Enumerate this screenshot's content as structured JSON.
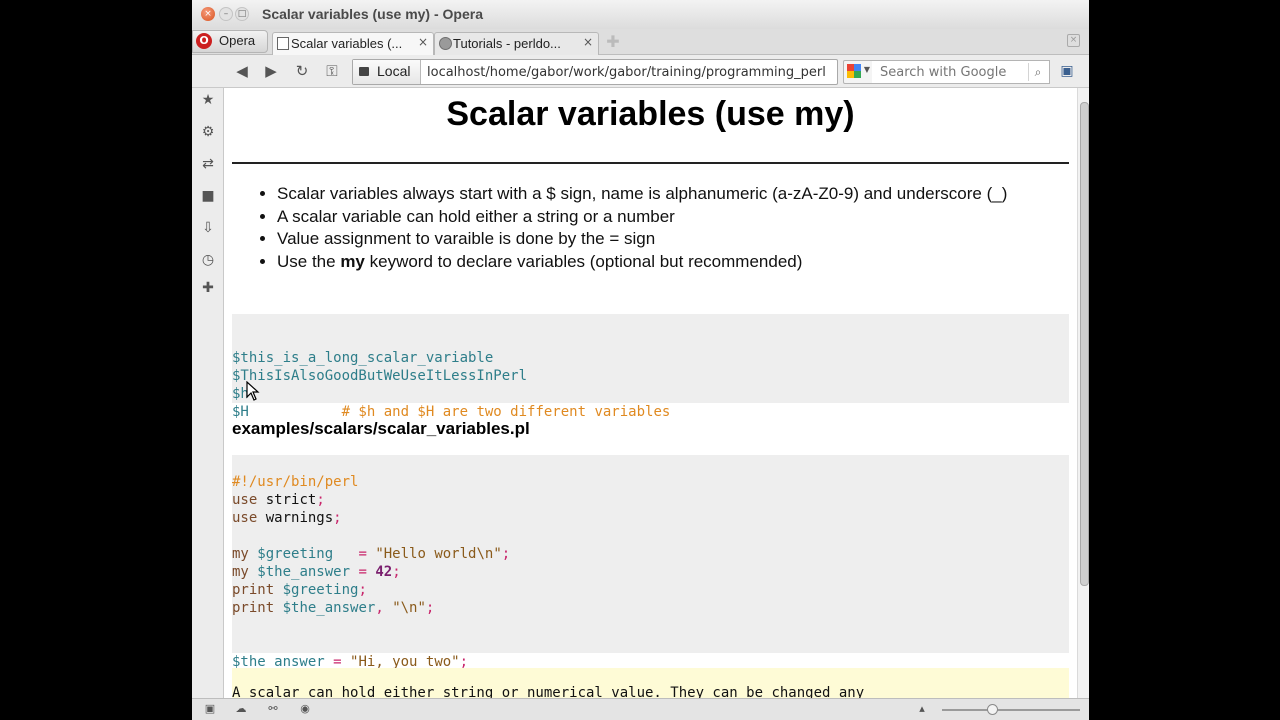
{
  "window": {
    "title": "Scalar variables (use my) - Opera",
    "close_glyph": "×",
    "minimize_glyph": "–",
    "maximize_glyph": "□"
  },
  "tabs": {
    "menu_label": "Opera",
    "items": [
      {
        "title": "Scalar variables (...",
        "close": "×"
      },
      {
        "title": "Tutorials - perldo...",
        "close": "×"
      }
    ]
  },
  "toolbar": {
    "security_label": "Local",
    "address": "localhost/home/gabor/work/gabor/training/programming_perl",
    "search_placeholder": "Search with Google"
  },
  "page": {
    "title": "Scalar variables (use my)",
    "bullets": [
      "Scalar variables always start with a $ sign, name is alphanumeric (a-zA-Z0-9) and underscore (_)",
      "A scalar variable can hold either a string or a number",
      "Value assignment to varaible is done by the = sign"
    ],
    "bullet4": {
      "before": "Use the ",
      "bold": "my",
      "after": " keyword to declare variables (optional but recommended)"
    },
    "code1": {
      "lines": [
        "$this_is_a_long_scalar_variable",
        "$ThisIsAlsoGoodButWeUseItLessInPerl",
        "$h",
        "$H"
      ],
      "comment": "# $h and $H are two different variables"
    },
    "filename": "examples/scalars/scalar_variables.pl",
    "code2": {
      "shebang": "#!/usr/bin/perl",
      "use1_kw": "use",
      "use1_arg": "strict",
      "semi": ";",
      "use2_kw": "use",
      "use2_arg": "warnings",
      "my_kw": "my",
      "var_greeting": "$greeting",
      "eq": "=",
      "str_hello": "\"Hello world\\n\"",
      "var_answer": "$the_answer",
      "num_42": "42",
      "print_kw": "print",
      "comma": ",",
      "str_nl": "\"\\n\"",
      "str_hi": "\"Hi, you two\""
    },
    "note": "A scalar can hold either string or numerical value. They can be changed any"
  }
}
